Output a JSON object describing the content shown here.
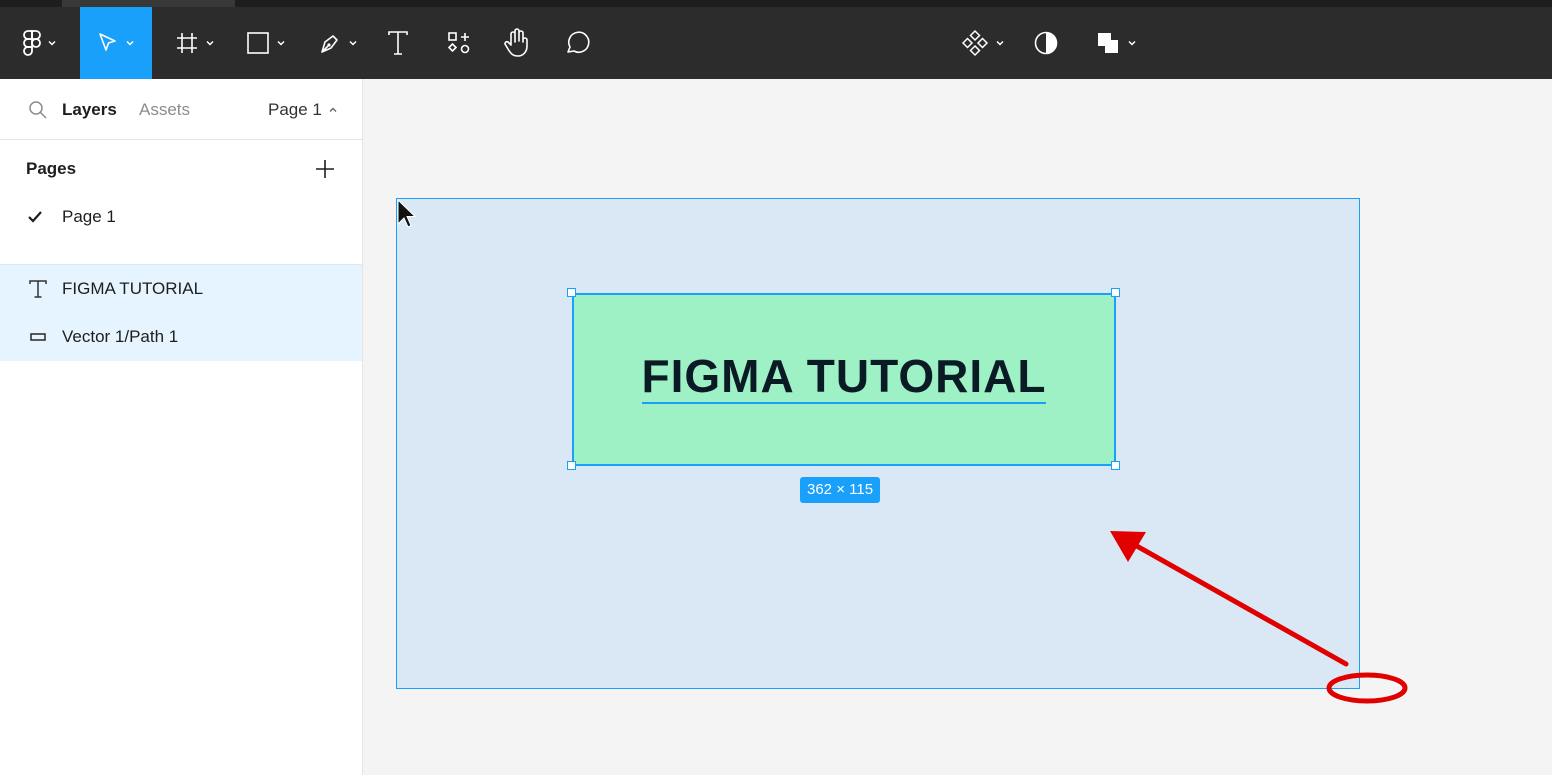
{
  "toolbar": {
    "tools": [
      "figma-menu",
      "move",
      "frame",
      "shape",
      "pen",
      "text",
      "resources",
      "hand",
      "comment",
      "component",
      "mask",
      "boolean"
    ],
    "active_tool": "move",
    "accent": "#18a0fb"
  },
  "left_panel": {
    "tabs": {
      "layers": "Layers",
      "assets": "Assets"
    },
    "current_page": "Page 1",
    "pages_title": "Pages",
    "pages": [
      {
        "label": "Page 1",
        "checked": true
      }
    ],
    "layers": [
      {
        "label": "FIGMA TUTORIAL",
        "icon": "text-icon"
      },
      {
        "label": "Vector 1/Path 1",
        "icon": "vector-rect-icon"
      }
    ]
  },
  "canvas": {
    "frame_color": "#dae8f5",
    "rect_color": "#9ef1c4",
    "rect_text": "FIGMA TUTORIAL",
    "selection_size": "362 × 115",
    "annotation_color": "#e00000"
  }
}
